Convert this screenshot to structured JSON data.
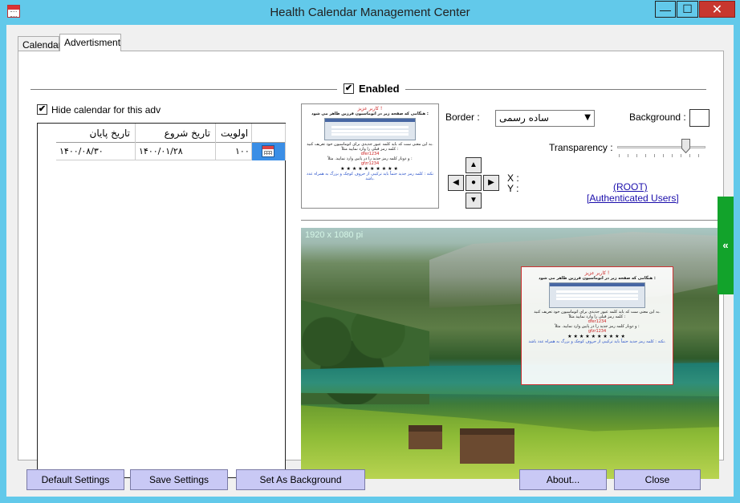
{
  "window": {
    "title": "Health Calendar Management Center",
    "controls": {
      "minimize": "—",
      "maximize": "☐",
      "close": "✕"
    }
  },
  "tabs": [
    {
      "label": "Calendar"
    },
    {
      "label": "Advertisment"
    }
  ],
  "enabled": {
    "label": "Enabled",
    "checked": true
  },
  "hide_calendar": {
    "label": "Hide calendar for this adv",
    "checked": true
  },
  "grid": {
    "columns": [
      "اولویت",
      "تاریخ شروع",
      "تاریخ پایان"
    ],
    "rows": [
      {
        "priority": "۱۰۰",
        "start": "۱۴۰۰/۰۱/۲۸",
        "end": "۱۴۰۰/۰۸/۳۰"
      }
    ]
  },
  "ad_preview": {
    "title": "کاربر عزیز !",
    "heading": "هنگامی که صفحه زیر در اتوماسیون فرزین ظاهر می شود :",
    "body1": "به این معنی ست که باید کلمه عبور جدیدی برای اتوماسیون خود تعریف کنید.",
    "body2": "کلمه رمز قبلی را وارد نمایید مثلاً :",
    "example1": "dfer1234",
    "body3": "و دوبار کلمه رمز جدید را در پایین وارد نمایید. مثلاً :",
    "example2": "gfzr1234",
    "stars": "★★★★★★★★★★",
    "note": "نکته : کلمه رمز جدید حتماً باید ترکیبی از حروف کوچک و بزرگ به همراه عدد باشد."
  },
  "border": {
    "label": "Border :",
    "value": "ساده رسمی"
  },
  "background": {
    "label": "Background :",
    "color": "#ffffff"
  },
  "transparency": {
    "label": "Transparency :",
    "value": 0.8
  },
  "position": {
    "up": "▲",
    "down": "▼",
    "left": "◀",
    "right": "▶",
    "center": "●",
    "x_label": "X :",
    "y_label": "Y :"
  },
  "permissions": {
    "root": "(ROOT)",
    "users": "[Authenticated Users]"
  },
  "preview": {
    "resolution": "1920 x 1080 pi"
  },
  "side_nav": {
    "label": "«"
  },
  "buttons": {
    "default_settings": "Default Settings",
    "save_settings": "Save Settings",
    "set_as_background": "Set As Background",
    "about": "About...",
    "close": "Close"
  }
}
